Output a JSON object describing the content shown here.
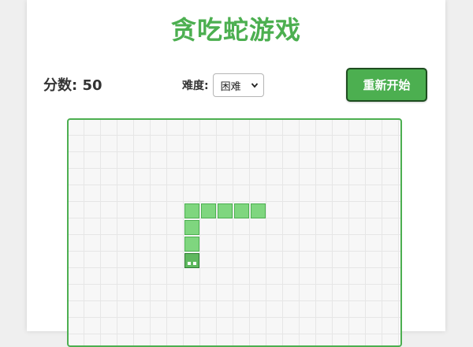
{
  "game": {
    "title": "贪吃蛇游戏",
    "score_label": "分数: 50",
    "difficulty_label": "难度:",
    "difficulty_selected": "困难",
    "restart_label": "重新开始"
  },
  "colors": {
    "accent": "#4caf50",
    "snake_body": "#7fd67f",
    "snake_head": "#5fb85f",
    "board_background": "#f7f7f7"
  },
  "icons": {
    "select_arrow": "chevron-down-icon"
  }
}
